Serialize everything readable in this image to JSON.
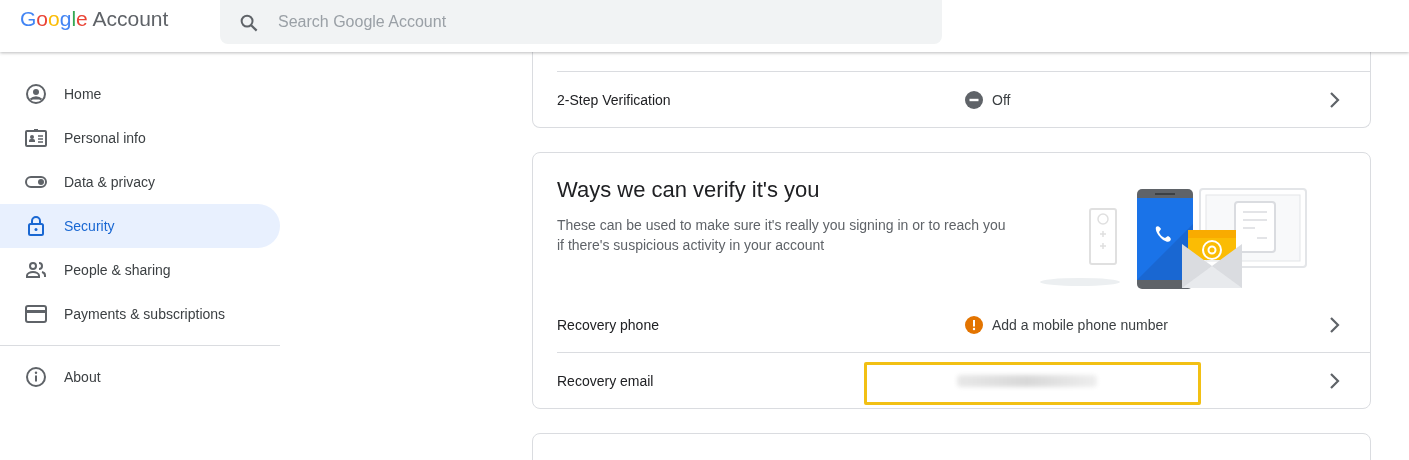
{
  "header": {
    "logo": "Google",
    "product": "Account",
    "search": {
      "placeholder": "Search Google Account"
    }
  },
  "sidebar": {
    "items": [
      {
        "label": "Home",
        "kind": "home",
        "selected": false
      },
      {
        "label": "Personal info",
        "kind": "person",
        "selected": false
      },
      {
        "label": "Data & privacy",
        "kind": "toggle",
        "selected": false
      },
      {
        "label": "Security",
        "kind": "lock",
        "selected": true
      },
      {
        "label": "People & sharing",
        "kind": "people",
        "selected": false
      },
      {
        "label": "Payments & subscriptions",
        "kind": "card",
        "selected": false
      }
    ],
    "footer_items": [
      {
        "label": "About",
        "kind": "info",
        "selected": false
      }
    ]
  },
  "cards": [
    {
      "rows": [
        {
          "label": "2-Step Verification",
          "status": "Off",
          "kind": "off"
        }
      ]
    },
    {
      "title": "Ways we can verify it's you",
      "description": "These can be used to make sure it's really you signing in or to reach you if there's suspicious activity in your account",
      "illustration": true,
      "rows": [
        {
          "label": "Recovery phone",
          "status": "Add a mobile phone number",
          "kind": "warning"
        },
        {
          "label": "Recovery email",
          "kind": "redacted",
          "highlighted": true
        }
      ]
    }
  ]
}
